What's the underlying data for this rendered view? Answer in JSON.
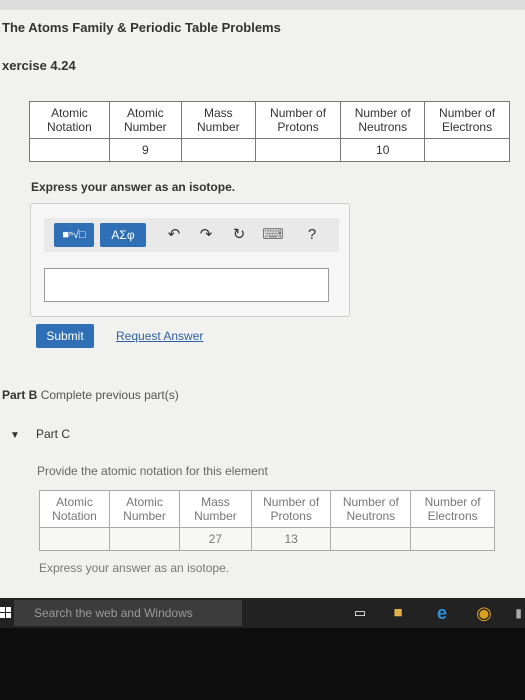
{
  "title": "The Atoms Family & Periodic Table Problems",
  "exercise": "xercise 4.24",
  "table1": {
    "headers": [
      "Atomic\nNotation",
      "Atomic\nNumber",
      "Mass\nNumber",
      "Number of\nProtons",
      "Number of\nNeutrons",
      "Number of\nElectrons"
    ],
    "values": [
      "",
      "9",
      "",
      "",
      "10",
      ""
    ]
  },
  "prompt1": "Express your answer as an isotope.",
  "toolbar": {
    "template_glyph": "■ⁿ√□",
    "greek_label": "ΑΣφ",
    "undo": "↶",
    "redo": "↷",
    "reset": "↻",
    "keyboard": "⌨",
    "help": "?"
  },
  "answer": {
    "value": ""
  },
  "submit_label": "Submit",
  "request_answer_label": "Request Answer",
  "partb": {
    "label": "Part B",
    "text": "Complete previous part(s)"
  },
  "partc": {
    "label": "Part C"
  },
  "prompt2": "Provide the atomic notation for this element",
  "table2": {
    "headers": [
      "Atomic\nNotation",
      "Atomic\nNumber",
      "Mass\nNumber",
      "Number of\nProtons",
      "Number of\nNeutrons",
      "Number of\nElectrons"
    ],
    "values": [
      "",
      "",
      "27",
      "13",
      "",
      ""
    ]
  },
  "prompt3": "Express your answer as an isotope.",
  "taskbar": {
    "search_placeholder": "Search the web and Windows"
  }
}
